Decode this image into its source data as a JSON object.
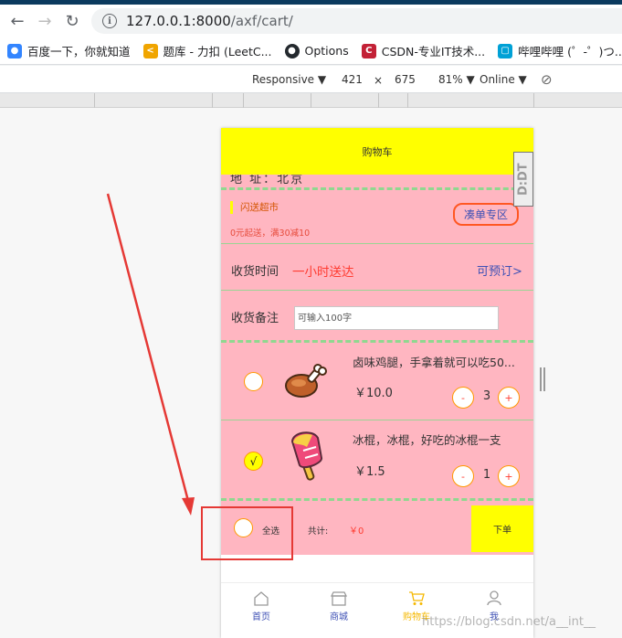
{
  "browser": {
    "url_host": "127.0.0.1:8000",
    "url_path": "/axf/cart/",
    "bookmarks": [
      {
        "label": "百度一下，你就知道",
        "color": "#3385ff"
      },
      {
        "label": "题库 - 力扣 (LeetC...",
        "color": "#f0a500"
      },
      {
        "label": "Options",
        "color": "#24292e"
      },
      {
        "label": "CSDN-专业IT技术...",
        "color": "#c32136"
      },
      {
        "label": "哔哩哔哩 (゜-゜)つ...",
        "color": "#00a1d6"
      }
    ]
  },
  "devtools": {
    "device": "Responsive",
    "width": "421",
    "times": "×",
    "height": "675",
    "zoom": "81%",
    "network": "Online"
  },
  "app": {
    "header_title": "购物车",
    "address_cut": "地 址：北京",
    "store": {
      "name": "闪送超市",
      "subtitle": "0元起送，满30减10",
      "promo_button": "凑单专区"
    },
    "delivery": {
      "label": "收货时间",
      "value": "一小时送达",
      "preorder": "可预订>"
    },
    "remark": {
      "label": "收货备注",
      "placeholder": "可输入100字"
    },
    "items": [
      {
        "name": "卤味鸡腿，手拿着就可以吃50...",
        "price": "￥10.0",
        "qty": "3",
        "checked": false,
        "check_mark": "",
        "minus": "-",
        "plus": "+"
      },
      {
        "name": "冰棍，冰棍，好吃的冰棍一支",
        "price": "￥1.5",
        "qty": "1",
        "checked": true,
        "check_mark": "√",
        "minus": "-",
        "plus": "+"
      }
    ],
    "footer": {
      "select_all": "全选",
      "total_label": "共计:",
      "total_value": "￥0",
      "order_button": "下单"
    },
    "tabs": [
      {
        "label": "首页",
        "icon": "home-icon",
        "active": false
      },
      {
        "label": "商城",
        "icon": "shop-icon",
        "active": false
      },
      {
        "label": "购物车",
        "icon": "cart-icon",
        "active": true
      },
      {
        "label": "我",
        "icon": "user-icon",
        "active": false
      }
    ]
  },
  "overlay": {
    "badge": "D:DT",
    "watermark": "https://blog.csdn.net/a__int__"
  },
  "colors": {
    "header_yellow": "#ffff00",
    "content_pink": "#ffb6c1",
    "dash_green": "#8fd88f",
    "annotation_red": "#e53935"
  }
}
